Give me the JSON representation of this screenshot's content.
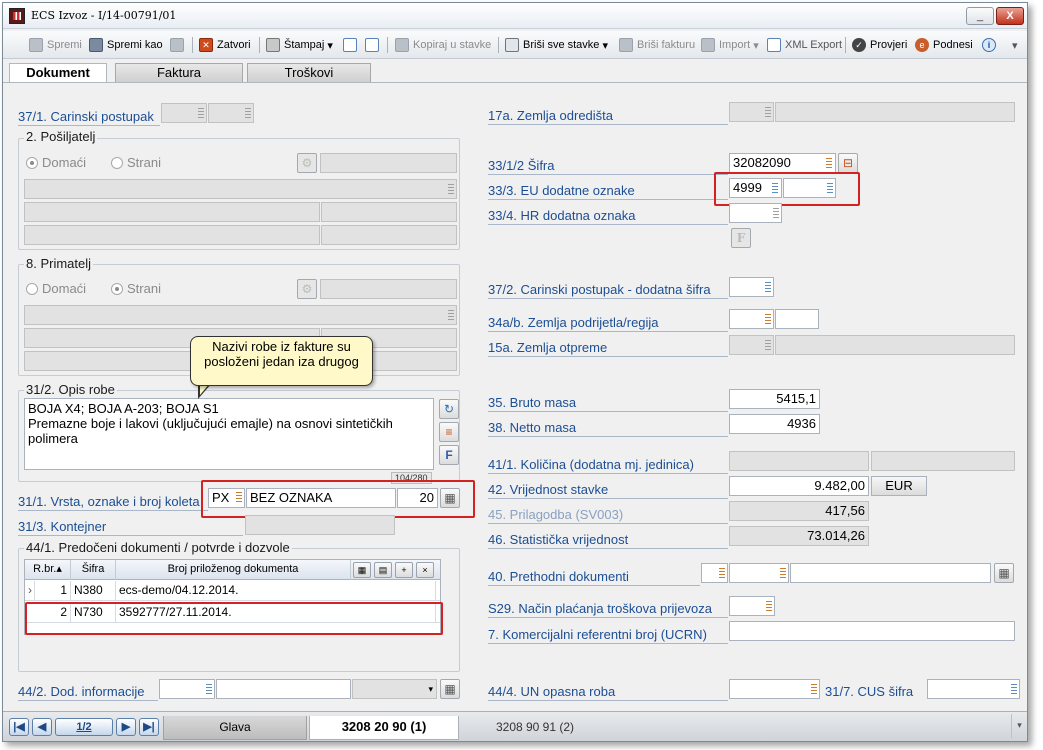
{
  "window": {
    "title": "ECS Izvoz - I/14-00791/01",
    "minimize_label": "_",
    "close_label": "X"
  },
  "toolbar": {
    "spremi": "Spremi",
    "spremi_kao": "Spremi kao",
    "zatvori": "Zatvori",
    "stampaj": "Štampaj",
    "kopiraj": "Kopiraj u stavke",
    "brisi_sve": "Briši sve stavke",
    "brisi_fakturu": "Briši fakturu",
    "import": "Import",
    "xml_export": "XML Export",
    "provjeri": "Provjeri",
    "podnesi": "Podnesi"
  },
  "tabs": {
    "dokument": "Dokument",
    "faktura": "Faktura",
    "troskovi": "Troškovi"
  },
  "left": {
    "carinski_postupak": "37/1. Carinski postupak",
    "posiljatelj": "2. Pošiljatelj",
    "domaci": "Domaći",
    "strani": "Strani",
    "primatelj": "8. Primatelj",
    "opis_robe": "31/2. Opis robe",
    "opis_text": "BOJA X4; BOJA A-203; BOJA S1\nPremazne boje i lakovi (uključujući emajle) na osnovi sintetičkih polimera",
    "counter": "104/280",
    "vrsta": "31/1. Vrsta, oznake i broj koleta",
    "vrsta_code": "PX",
    "vrsta_oznake": "BEZ OZNAKA",
    "vrsta_broj": "20",
    "kontejner": "31/3. Kontejner",
    "predoceni": "44/1. Predočeni dokumenti / potvrde i dozvole",
    "dod_info": "44/2. Dod. informacije"
  },
  "grid": {
    "headers": [
      "R.br.",
      "Šifra",
      "Broj priloženog dokumenta"
    ],
    "rows": [
      {
        "rbr": "1",
        "sifra": "N380",
        "broj": "ecs-demo/04.12.2014."
      },
      {
        "rbr": "2",
        "sifra": "N730",
        "broj": "3592777/27.11.2014."
      }
    ]
  },
  "callout": "Nazivi robe iz fakture su posloženi jedan iza drugog",
  "right": {
    "zemlja_odredista": "17a. Zemlja odredišta",
    "sifra": "33/1/2 Šifra",
    "sifra_value": "32082090",
    "eu_oznake": "33/3. EU dodatne oznake",
    "eu_value": "4999",
    "hr_oznaka": "33/4. HR dodatna oznaka",
    "cp_dodatna": "37/2. Carinski postupak - dodatna šifra",
    "zemlja_podrijetla": "34a/b. Zemlja podrijetla/regija",
    "zemlja_otpreme": "15a. Zemlja otpreme",
    "bruto": "35. Bruto masa",
    "bruto_value": "5415,1",
    "netto": "38. Netto masa",
    "netto_value": "4936",
    "kolicina": "41/1. Količina (dodatna mj. jedinica)",
    "vrijednost": "42. Vrijednost stavke",
    "vrijednost_value": "9.482,00",
    "valuta": "EUR",
    "prilagodba": "45. Prilagodba (SV003)",
    "prilagodba_value": "417,56",
    "statisticka": "46. Statistička vrijednost",
    "statisticka_value": "73.014,26",
    "prethodni": "40. Prethodni dokumenti",
    "nacin_placanja": "S29. Način plaćanja troškova prijevoza",
    "ucrn": "7. Komercijalni referentni broj (UCRN)",
    "un_opasna": "44/4. UN opasna roba",
    "cus": "31/7. CUS šifra"
  },
  "status": {
    "page": "1/2",
    "glava": "Glava",
    "item1": "3208 20 90  (1)",
    "item2": "3208 90 91  (2)"
  },
  "colors": {
    "label_blue": "#1c4e93",
    "highlight_red": "#d42222",
    "callout_bg": "#fff8c8"
  }
}
